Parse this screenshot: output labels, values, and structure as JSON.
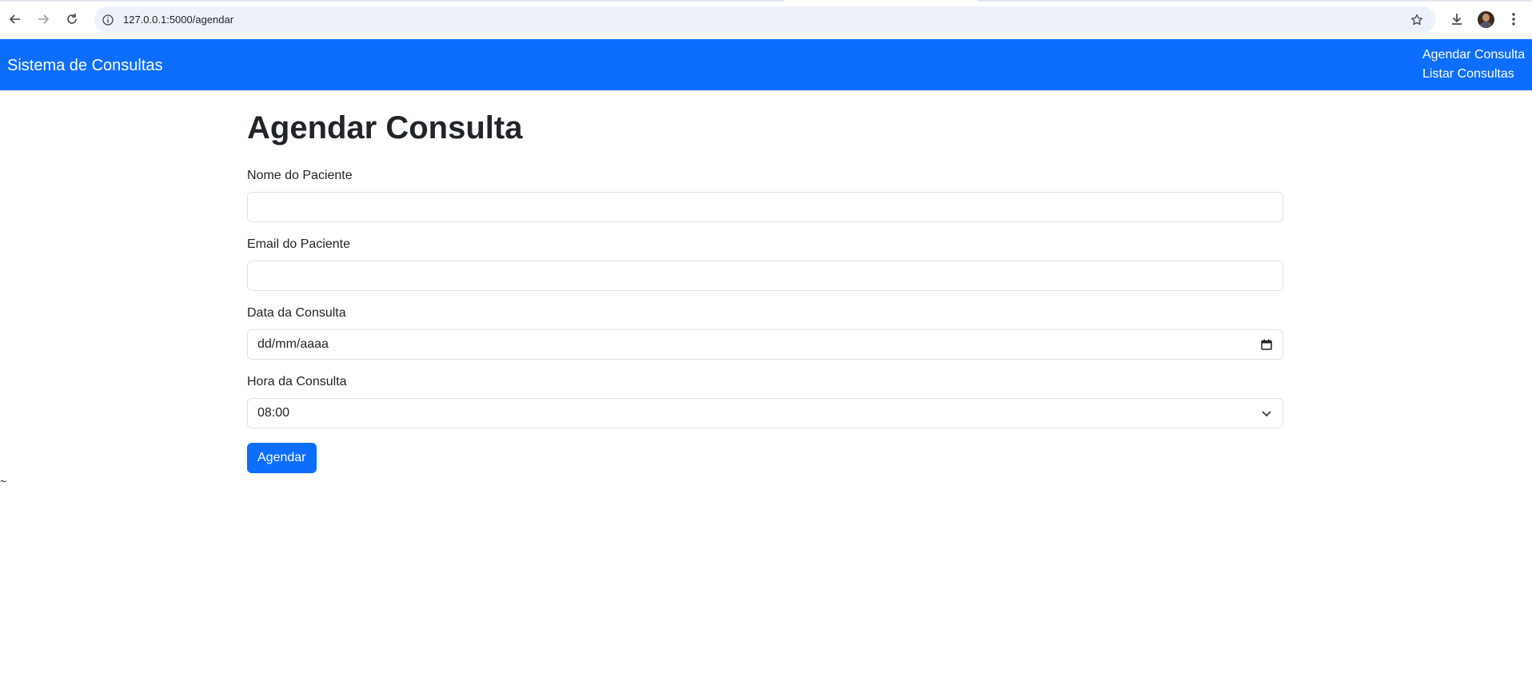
{
  "browser": {
    "url": "127.0.0.1:5000/agendar",
    "icons": [
      "back-icon",
      "forward-icon",
      "reload-icon",
      "info-icon",
      "star-icon",
      "download-icon",
      "avatar",
      "more-icon"
    ]
  },
  "navbar": {
    "brand": "Sistema de Consultas",
    "links": [
      "Agendar Consulta",
      "Listar Consultas"
    ],
    "color": "#0d6efd"
  },
  "form": {
    "title": "Agendar Consulta",
    "fields": [
      {
        "label": "Nome do Paciente",
        "value": ""
      },
      {
        "label": "Email do Paciente",
        "value": ""
      },
      {
        "label": "Data da Consulta",
        "value": "dd/mm/aaaa"
      },
      {
        "label": "Hora da Consulta",
        "value": "08:00"
      }
    ],
    "submit_label": "Agendar"
  },
  "stray_text": "~"
}
